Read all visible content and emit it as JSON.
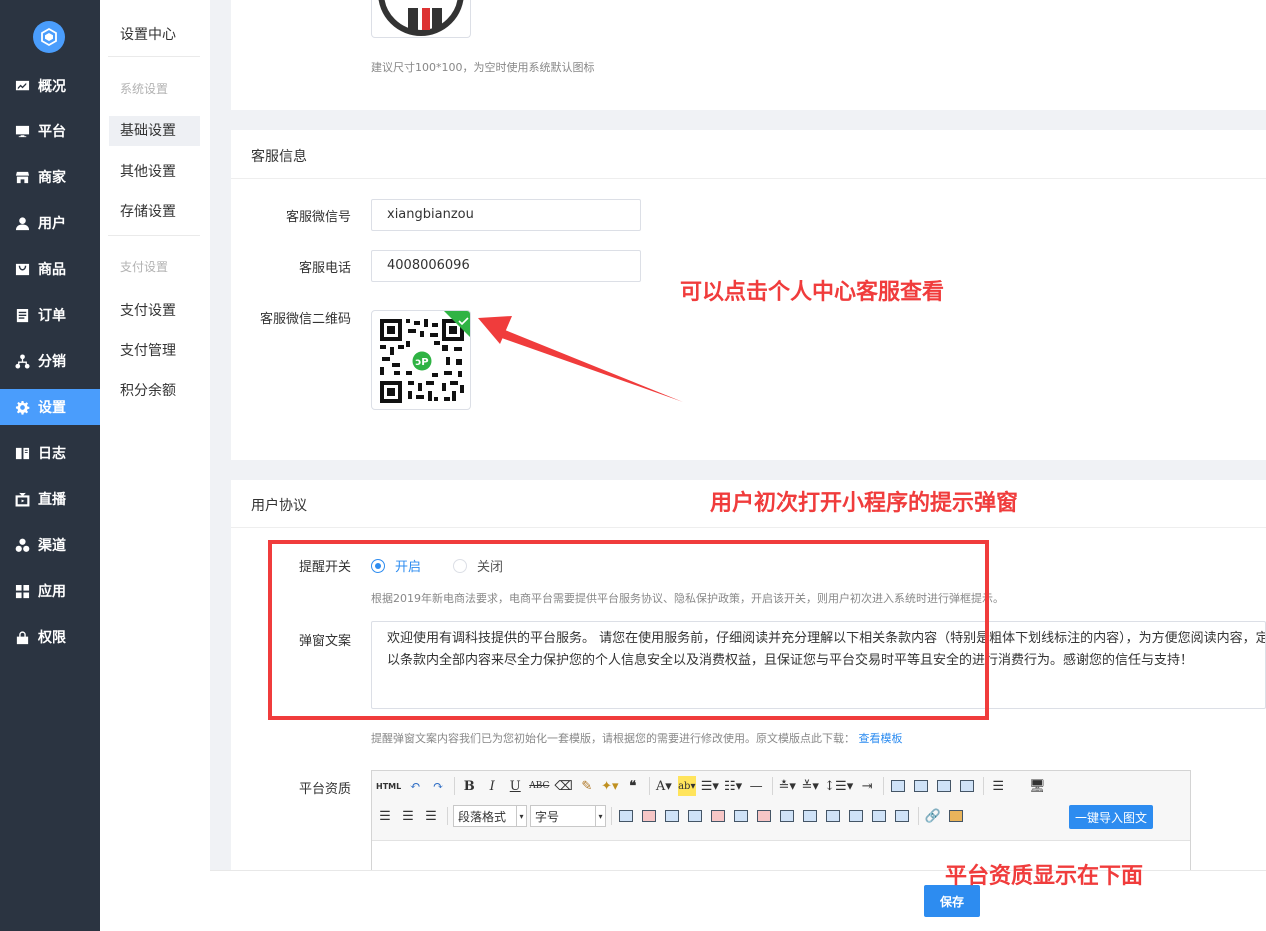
{
  "sidebar": {
    "items": [
      {
        "label": "概况",
        "icon": "dashboard-icon"
      },
      {
        "label": "平台",
        "icon": "monitor-icon"
      },
      {
        "label": "商家",
        "icon": "store-icon"
      },
      {
        "label": "用户",
        "icon": "user-icon"
      },
      {
        "label": "商品",
        "icon": "goods-icon"
      },
      {
        "label": "订单",
        "icon": "order-icon"
      },
      {
        "label": "分销",
        "icon": "distribution-icon"
      },
      {
        "label": "设置",
        "icon": "gear-icon",
        "active": true
      },
      {
        "label": "日志",
        "icon": "book-icon"
      },
      {
        "label": "直播",
        "icon": "tv-icon"
      },
      {
        "label": "渠道",
        "icon": "channel-icon"
      },
      {
        "label": "应用",
        "icon": "grid-icon"
      },
      {
        "label": "权限",
        "icon": "lock-icon"
      }
    ]
  },
  "submenu": {
    "title": "设置中心",
    "group1": "系统设置",
    "group2": "支付设置",
    "items": [
      "基础设置",
      "其他设置",
      "存储设置",
      "支付设置",
      "支付管理",
      "积分余额"
    ]
  },
  "logo_section": {
    "hint": "建议尺寸100*100，为空时使用系统默认图标"
  },
  "service": {
    "heading": "客服信息",
    "wechat_label": "客服微信号",
    "wechat_value": "xiangbianzou",
    "phone_label": "客服电话",
    "phone_value": "4008006096",
    "qrcode_label": "客服微信二维码"
  },
  "agreement": {
    "heading": "用户协议",
    "switch_label": "提醒开关",
    "on_label": "开启",
    "off_label": "关闭",
    "switch_hint": "根据2019年新电商法要求，电商平台需要提供平台服务协议、隐私保护政策，开启该开关，则用户初次进入系统时进行弹框提示。",
    "popup_label": "弹窗文案",
    "popup_text_line1": "欢迎使用有调科技提供的平台服务。 请您在使用服务前，仔细阅读并充分理解以下相关条款内容（特别是粗体下划线标注的内容），为方便您阅读内容，定",
    "popup_text_line2": "以条款内全部内容来尽全力保护您的个人信息安全以及消费权益，且保证您与平台交易时平等且安全的进行消费行为。感谢您的信任与支持！",
    "popup_hint": "提醒弹窗文案内容我们已为您初始化一套模版，请根据您的需要进行修改使用。原文模版点此下载：",
    "popup_hint_link": "查看模板",
    "qualification_label": "平台资质"
  },
  "editor": {
    "html_label": "HTML",
    "paragraph_select": "段落格式",
    "font_size_select": "字号",
    "import_button": "一键导入图文"
  },
  "footer": {
    "save_label": "保存"
  },
  "annotations": {
    "qrcode_note": "可以点击个人中心客服查看",
    "popup_note": "用户初次打开小程序的提示弹窗",
    "qualification_note": "平台资质显示在下面"
  },
  "colors": {
    "sidebar_bg": "#2b3441",
    "accent": "#4a9dfc",
    "primary": "#2d8cf0",
    "annotation": "#f03c3c"
  }
}
